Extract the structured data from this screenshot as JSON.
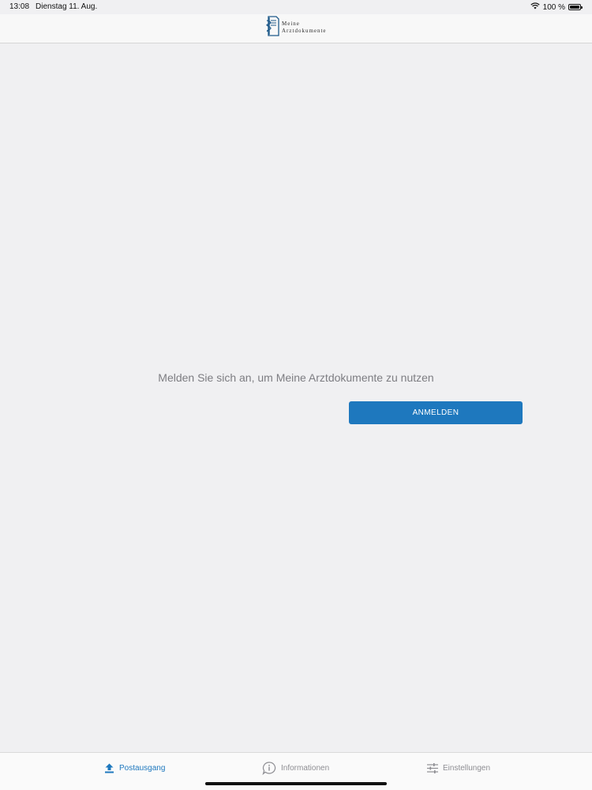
{
  "status_bar": {
    "time": "13:08",
    "date": "Dienstag 11. Aug.",
    "battery_label": "100 %",
    "battery_level": 1.0,
    "wifi_icon": "wifi-icon"
  },
  "header": {
    "logo_line1": "Meine",
    "logo_line2": "Arztdokumente",
    "logo_color": "#1f5a8a"
  },
  "main": {
    "message": "Melden Sie sich an, um Meine Arztdokumente zu nutzen",
    "login_button_label": "ANMELDEN",
    "accent_color": "#1e78be"
  },
  "tabs": [
    {
      "label": "Postausgang",
      "icon": "upload-icon",
      "active": true
    },
    {
      "label": "Informationen",
      "icon": "info-bubble-icon",
      "active": false
    },
    {
      "label": "Einstellungen",
      "icon": "sliders-icon",
      "active": false
    }
  ]
}
